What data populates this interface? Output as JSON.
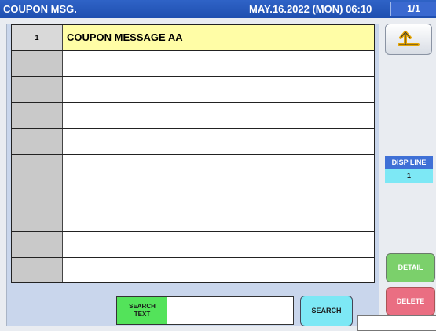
{
  "header": {
    "title": "COUPON MSG.",
    "datetime": "MAY.16.2022 (MON)  06:10",
    "page": "1/1"
  },
  "list": {
    "rows": [
      {
        "num": "1",
        "text": "COUPON MESSAGE AA",
        "selected": true
      },
      {
        "num": "",
        "text": ""
      },
      {
        "num": "",
        "text": ""
      },
      {
        "num": "",
        "text": ""
      },
      {
        "num": "",
        "text": ""
      },
      {
        "num": "",
        "text": ""
      },
      {
        "num": "",
        "text": ""
      },
      {
        "num": "",
        "text": ""
      },
      {
        "num": "",
        "text": ""
      },
      {
        "num": "",
        "text": ""
      }
    ]
  },
  "sidebar": {
    "back_icon": "return-arrow-icon",
    "disp_line_label": "DISP LINE",
    "disp_line_value": "1",
    "detail_label": "DETAIL",
    "delete_label": "DELETE"
  },
  "search": {
    "label": "SEARCH TEXT",
    "value": "",
    "button_label": "SEARCH"
  },
  "colors": {
    "titlebar": "#2f63c7",
    "selected_row": "#fffda6",
    "detail": "#7bd06b",
    "delete": "#ea6e82",
    "search_label": "#53e35a",
    "cyan": "#7de8f5"
  }
}
